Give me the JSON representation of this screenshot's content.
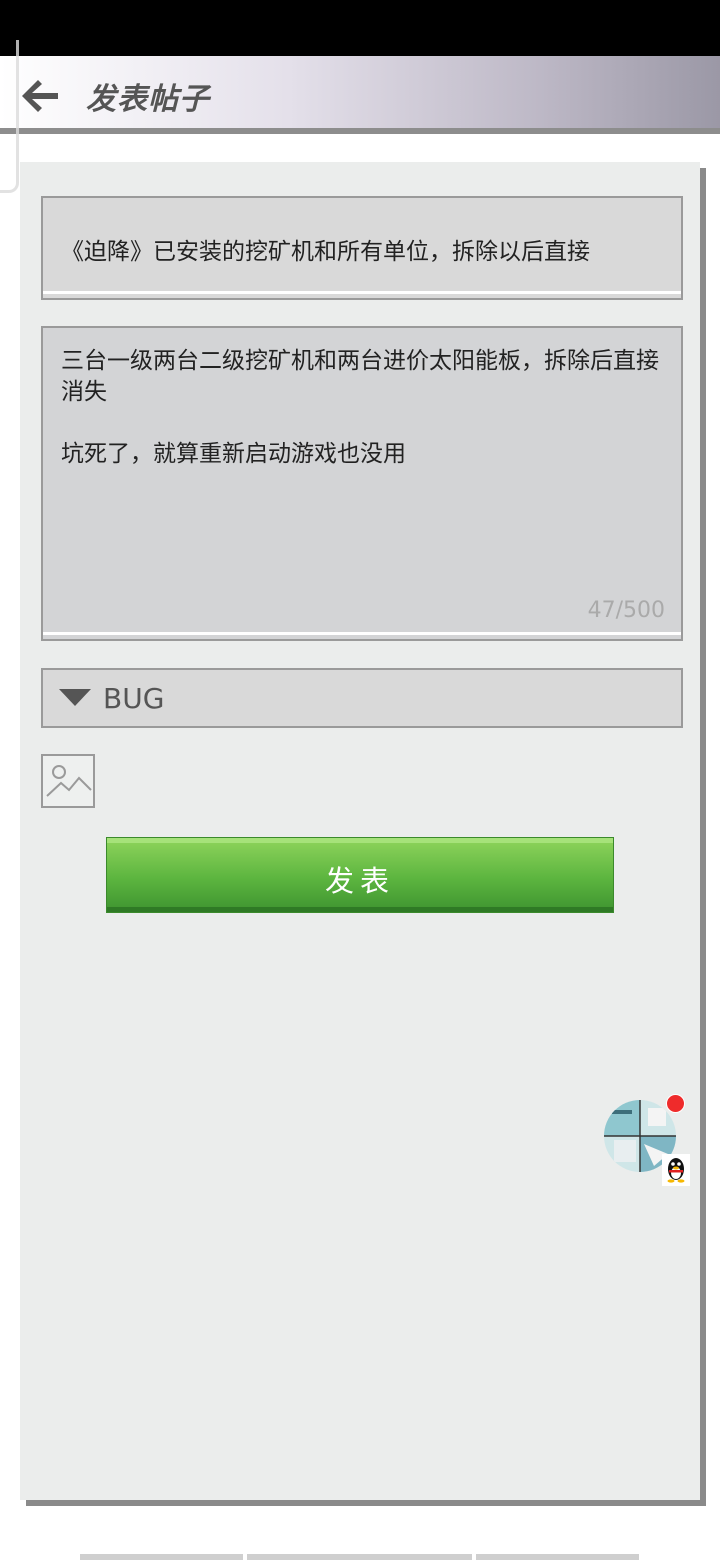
{
  "header": {
    "title": "发表帖子",
    "back_icon": "arrow-left-icon"
  },
  "form": {
    "title_value": "《迫降》已安装的挖矿机和所有单位，拆除以后直接",
    "content_value": "三台一级两台二级挖矿机和两台进价太阳能板，拆除后直接消失\n\n坑死了，就算重新启动游戏也没用",
    "char_count": "47/500",
    "category": "BUG",
    "category_icon": "triangle-down-icon",
    "image_icon": "image-icon"
  },
  "actions": {
    "publish_label": "发表"
  },
  "floating": {
    "avatar_icon": "user-avatar-icon",
    "badge_icon": "qq-penguin-icon"
  },
  "colors": {
    "publish_green": "#5cb53f",
    "panel_bg": "#ebedec",
    "notification_red": "#ef2b2b"
  }
}
